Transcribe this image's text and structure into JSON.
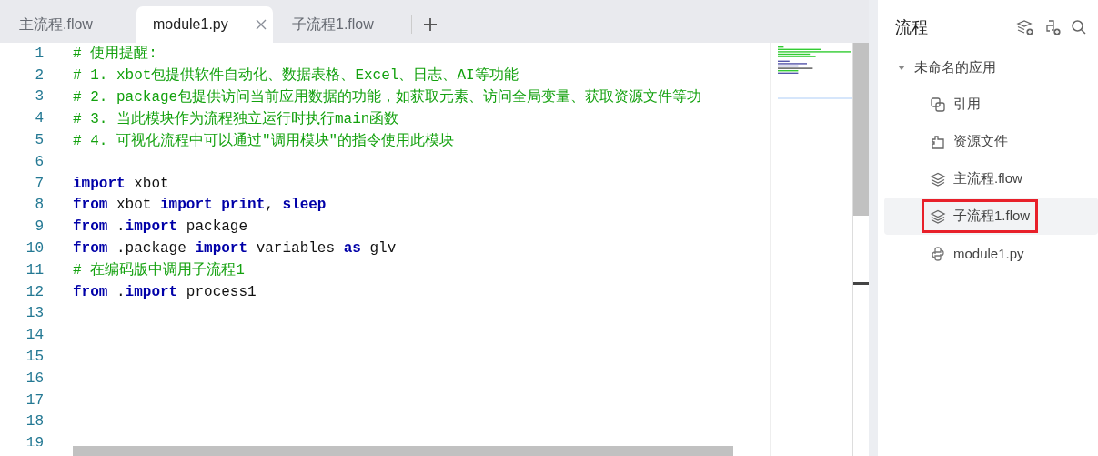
{
  "tabs": [
    {
      "label": "主流程.flow",
      "selected": false
    },
    {
      "label": "module1.py",
      "selected": true
    },
    {
      "label": "子流程1.flow",
      "selected": false
    }
  ],
  "editor": {
    "lines": [
      {
        "number": "1",
        "tokens": [
          {
            "kind": "comment",
            "text": "# 使用提醒:"
          }
        ]
      },
      {
        "number": "2",
        "tokens": [
          {
            "kind": "comment",
            "text": "# 1. xbot包提供软件自动化、数据表格、Excel、日志、AI等功能"
          }
        ]
      },
      {
        "number": "3",
        "tokens": [
          {
            "kind": "comment",
            "text": "# 2. package包提供访问当前应用数据的功能，如获取元素、访问全局变量、获取资源文件等功"
          }
        ]
      },
      {
        "number": "4",
        "tokens": [
          {
            "kind": "comment",
            "text": "# 3. 当此模块作为流程独立运行时执行main函数"
          }
        ]
      },
      {
        "number": "5",
        "tokens": [
          {
            "kind": "comment",
            "text": "# 4. 可视化流程中可以通过\"调用模块\"的指令使用此模块"
          }
        ]
      },
      {
        "number": "6"
      },
      {
        "number": "7",
        "tokens": [
          {
            "kind": "keyword",
            "text": "import"
          },
          {
            "kind": "plain",
            "text": " xbot"
          }
        ]
      },
      {
        "number": "8",
        "tokens": [
          {
            "kind": "keyword",
            "text": "from"
          },
          {
            "kind": "plain",
            "text": " xbot "
          },
          {
            "kind": "keyword",
            "text": "import"
          },
          {
            "kind": "keyword",
            "text": " print"
          },
          {
            "kind": "plain",
            "text": ", "
          },
          {
            "kind": "keyword",
            "text": "sleep"
          }
        ]
      },
      {
        "number": "9",
        "tokens": [
          {
            "kind": "keyword",
            "text": "from"
          },
          {
            "kind": "plain",
            "text": " ."
          },
          {
            "kind": "keyword",
            "text": "import"
          },
          {
            "kind": "plain",
            "text": " package"
          }
        ]
      },
      {
        "number": "10",
        "tokens": [
          {
            "kind": "keyword",
            "text": "from"
          },
          {
            "kind": "plain",
            "text": " .package "
          },
          {
            "kind": "keyword",
            "text": "import"
          },
          {
            "kind": "plain",
            "text": " variables "
          },
          {
            "kind": "keyword",
            "text": "as"
          },
          {
            "kind": "plain",
            "text": " glv"
          }
        ]
      },
      {
        "number": "11",
        "tokens": [
          {
            "kind": "comment",
            "text": "# 在编码版中调用子流程1"
          }
        ]
      },
      {
        "number": "12",
        "tokens": [
          {
            "kind": "keyword",
            "text": "from"
          },
          {
            "kind": "plain",
            "text": " ."
          },
          {
            "kind": "keyword",
            "text": "import"
          },
          {
            "kind": "plain",
            "text": " process1"
          }
        ]
      },
      {
        "number": "13"
      },
      {
        "number": "14"
      },
      {
        "number": "15"
      },
      {
        "number": "16"
      },
      {
        "number": "17"
      },
      {
        "number": "18"
      },
      {
        "number": "19"
      }
    ]
  },
  "sidebar": {
    "title": "流程",
    "tree": {
      "label": "未命名的应用",
      "expanded": true,
      "children": [
        {
          "label": "引用",
          "kind": "reference",
          "selected": false,
          "highlighted": false
        },
        {
          "label": "资源文件",
          "kind": "resource",
          "selected": false,
          "highlighted": false
        },
        {
          "label": "主流程.flow",
          "kind": "flow",
          "selected": false,
          "highlighted": false
        },
        {
          "label": "子流程1.flow",
          "kind": "flow",
          "selected": true,
          "highlighted": true
        },
        {
          "label": "module1.py",
          "kind": "python",
          "selected": false,
          "highlighted": false
        }
      ]
    }
  }
}
